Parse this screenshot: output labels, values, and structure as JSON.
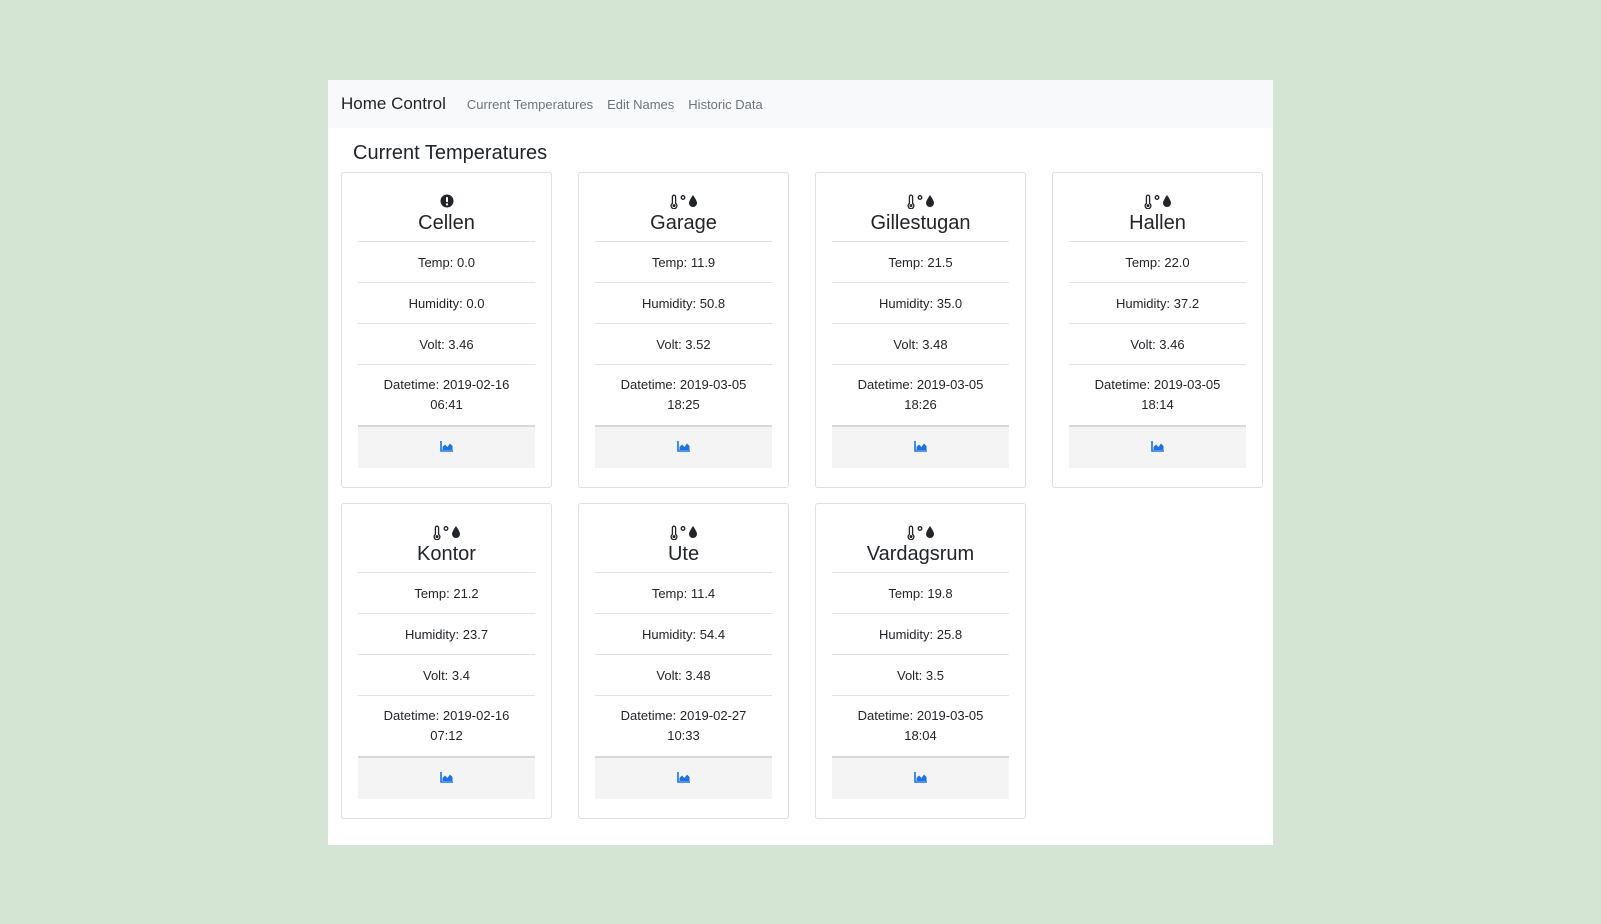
{
  "navbar": {
    "brand": "Home Control",
    "links": [
      "Current Temperatures",
      "Edit Names",
      "Historic Data"
    ]
  },
  "page_title": "Current Temperatures",
  "icons": {
    "status_ok": [
      "thermometer-icon",
      "degree-icon",
      "droplet-icon"
    ],
    "status_error": "exclamation-circle-icon",
    "chart": "area-chart-icon"
  },
  "colors": {
    "accent": "#1a73e8",
    "background": "#d4e5d3"
  },
  "sensors": [
    {
      "name": "Cellen",
      "status": "error",
      "temp": "Temp: 0.0",
      "humidity": "Humidity: 0.0",
      "volt": "Volt: 3.46",
      "datetime_date": "Datetime: 2019-02-16",
      "datetime_time": "06:41"
    },
    {
      "name": "Garage",
      "status": "ok",
      "temp": "Temp: 11.9",
      "humidity": "Humidity: 50.8",
      "volt": "Volt: 3.52",
      "datetime_date": "Datetime: 2019-03-05",
      "datetime_time": "18:25"
    },
    {
      "name": "Gillestugan",
      "status": "ok",
      "temp": "Temp: 21.5",
      "humidity": "Humidity: 35.0",
      "volt": "Volt: 3.48",
      "datetime_date": "Datetime: 2019-03-05",
      "datetime_time": "18:26"
    },
    {
      "name": "Hallen",
      "status": "ok",
      "temp": "Temp: 22.0",
      "humidity": "Humidity: 37.2",
      "volt": "Volt: 3.46",
      "datetime_date": "Datetime: 2019-03-05",
      "datetime_time": "18:14"
    },
    {
      "name": "Kontor",
      "status": "ok",
      "temp": "Temp: 21.2",
      "humidity": "Humidity: 23.7",
      "volt": "Volt: 3.4",
      "datetime_date": "Datetime: 2019-02-16",
      "datetime_time": "07:12"
    },
    {
      "name": "Ute",
      "status": "ok",
      "temp": "Temp: 11.4",
      "humidity": "Humidity: 54.4",
      "volt": "Volt: 3.48",
      "datetime_date": "Datetime: 2019-02-27",
      "datetime_time": "10:33"
    },
    {
      "name": "Vardagsrum",
      "status": "ok",
      "temp": "Temp: 19.8",
      "humidity": "Humidity: 25.8",
      "volt": "Volt: 3.5",
      "datetime_date": "Datetime: 2019-03-05",
      "datetime_time": "18:04"
    }
  ]
}
